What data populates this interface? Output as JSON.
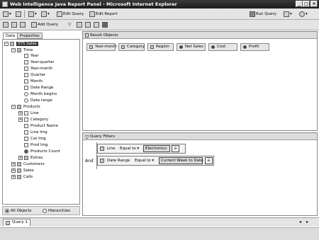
{
  "window": {
    "title": "Web Intelligence Java Report Panel - Microsoft Internet Explorer"
  },
  "toolbar1": {
    "edit_query": "Edit Query",
    "edit_report": "Edit Report",
    "run_query": "Run Query"
  },
  "toolbar2": {
    "add_query": "Add Query"
  },
  "left_tabs": {
    "data": "Data",
    "properties": "Properties"
  },
  "tree": {
    "root": "STS Sales",
    "time": "Time",
    "time_items": [
      "Year",
      "Year-quarter",
      "Year-month",
      "Quarter",
      "Month",
      "Date Range",
      "Month begins",
      "Date range"
    ],
    "products": "Products",
    "product_items": [
      "Line",
      "Category",
      "Product Name",
      "Line Img",
      "Cat Img",
      "Prod Img",
      "Products Count",
      "Extras"
    ],
    "others": [
      "Customers",
      "Sales",
      "Calls"
    ]
  },
  "view_mode": {
    "all_objects": "All Objects",
    "hierarchies": "Hierarchies"
  },
  "result_objects": {
    "title": "Result Objects",
    "items": [
      "Year-month",
      "Category",
      "Region",
      "Net Sales",
      "Cost",
      "Profit"
    ]
  },
  "query_filters": {
    "title": "Query Filters",
    "operator": "And",
    "conditions": [
      {
        "object": "Line",
        "op": "Equal to",
        "value": "Electronics"
      },
      {
        "object": "Date Range",
        "op": "Equal to",
        "value": "Current Week to Date"
      }
    ]
  },
  "query_tabs": [
    "Query 1"
  ]
}
